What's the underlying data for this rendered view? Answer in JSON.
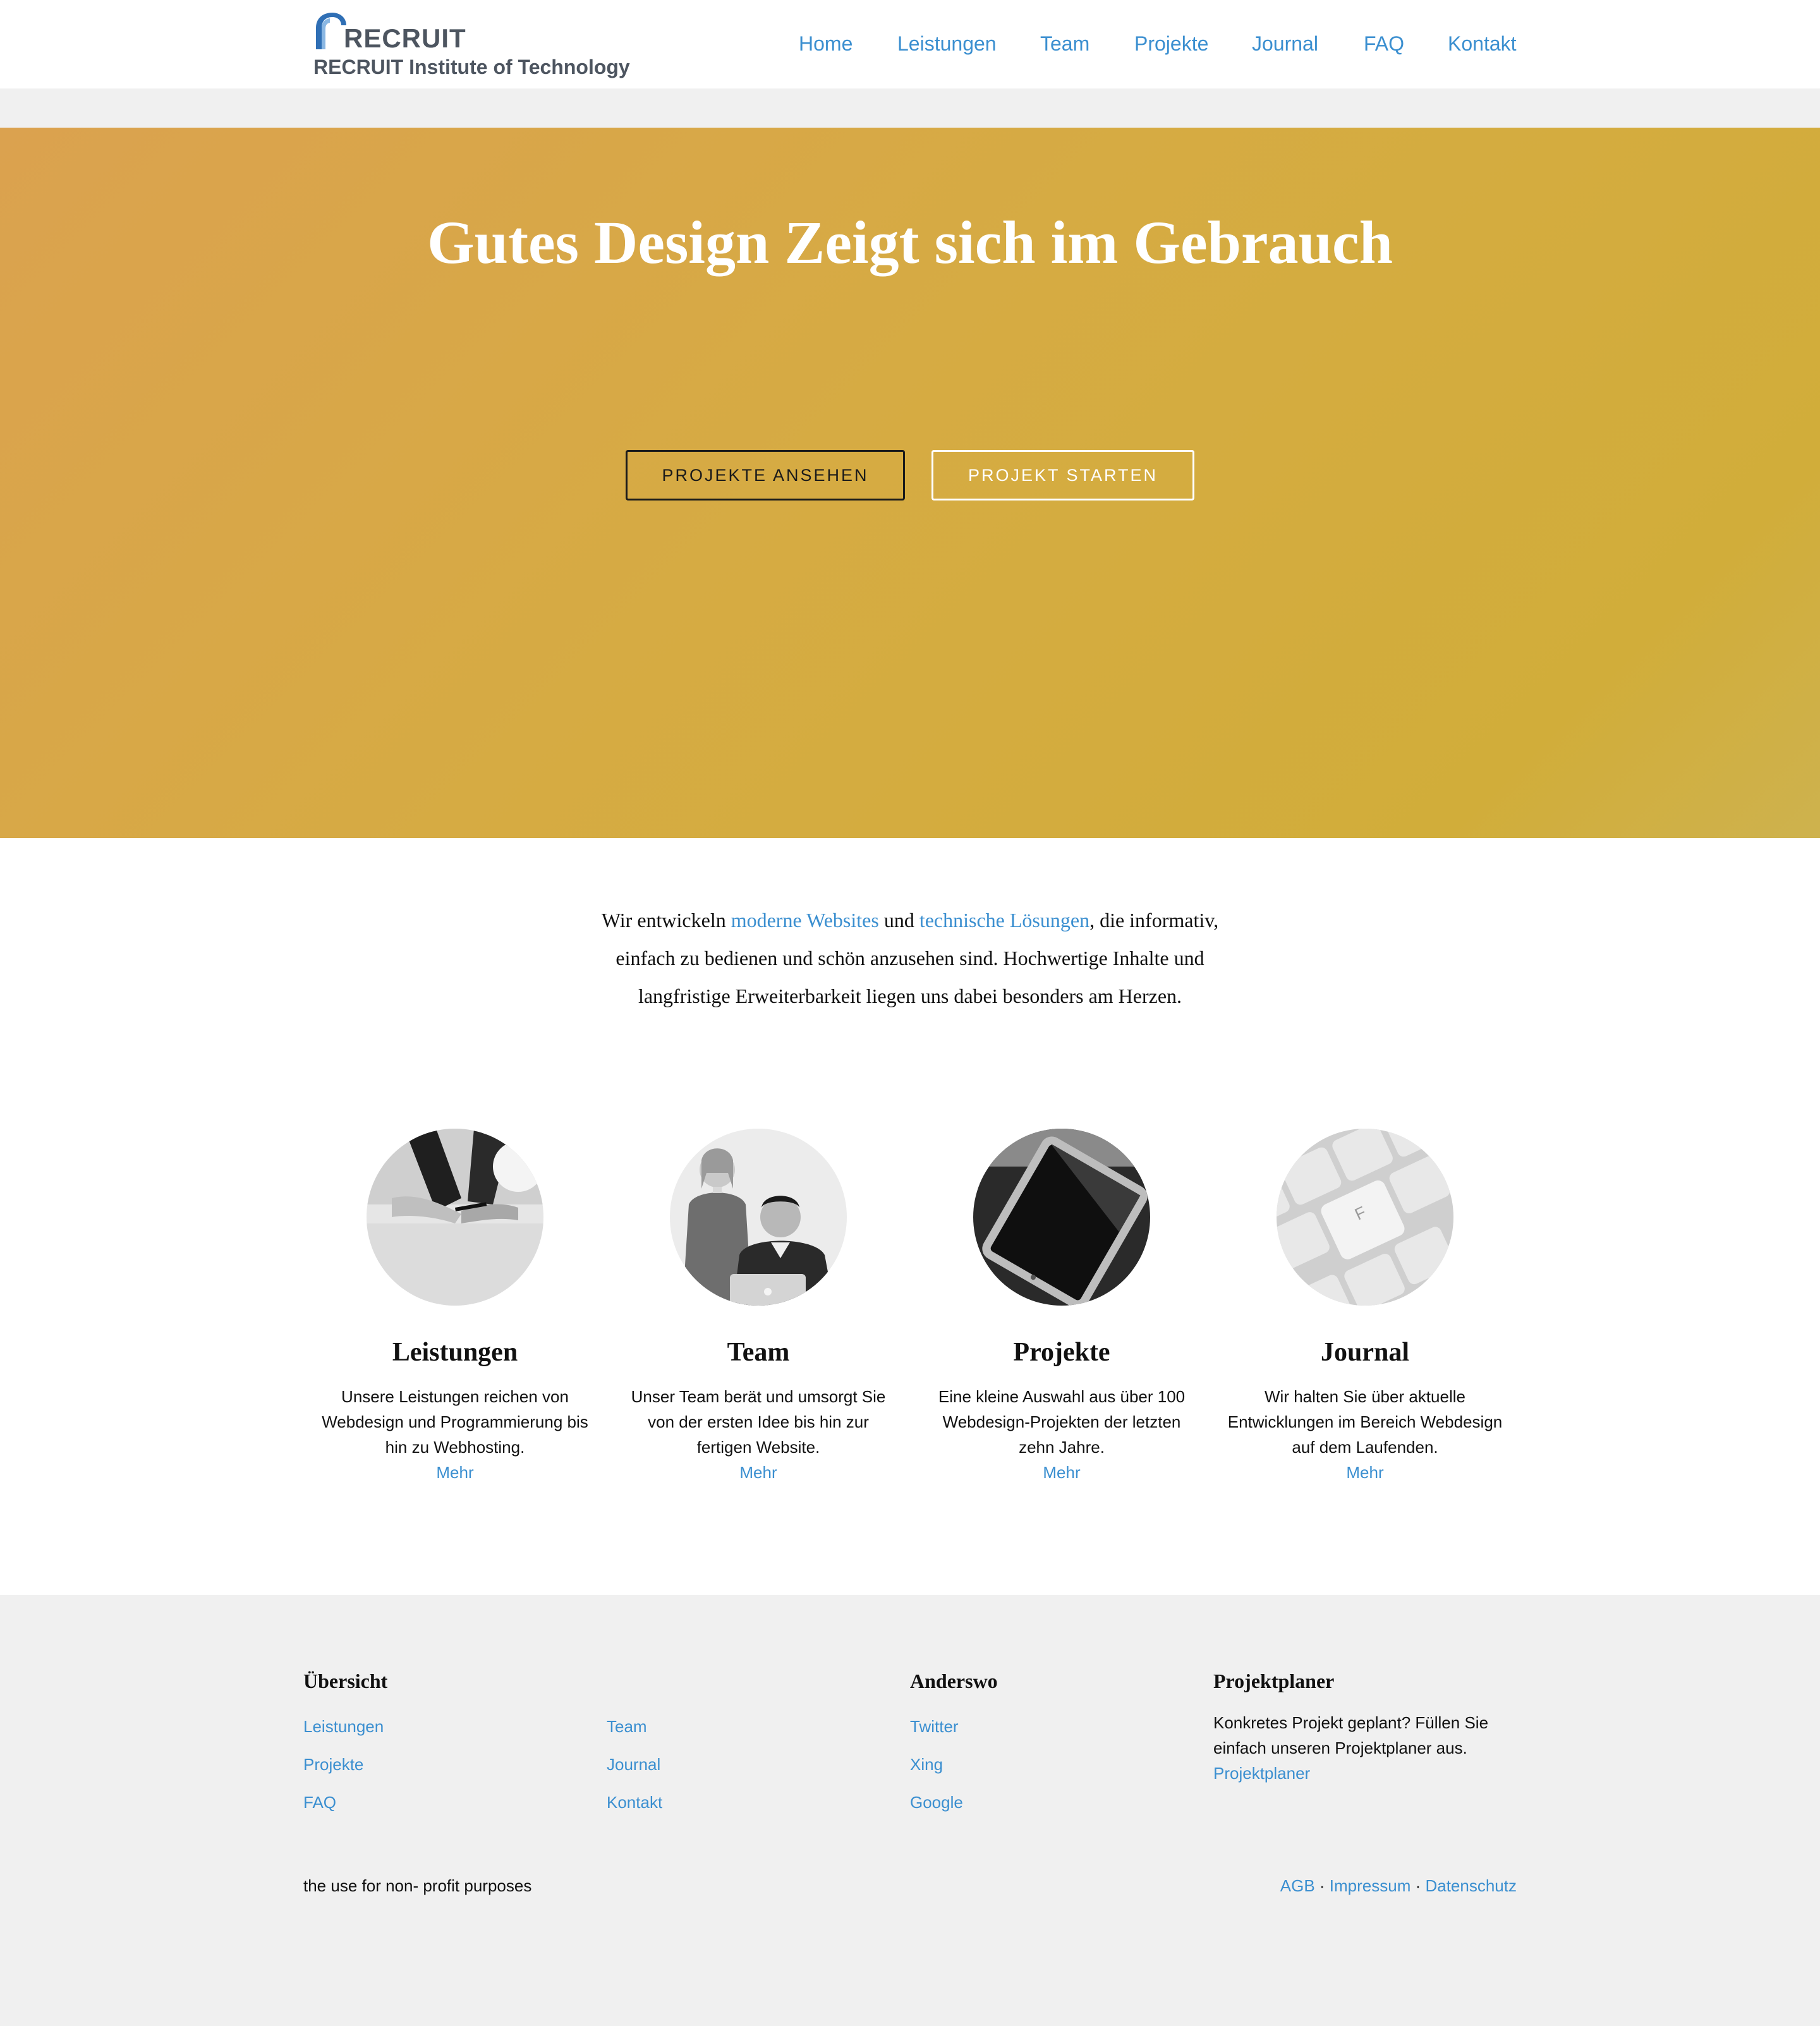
{
  "header": {
    "logo_word": "RECRUIT",
    "logo_subtitle": "RECRUIT Institute of Technology",
    "nav": [
      "Home",
      "Leistungen",
      "Team",
      "Projekte",
      "Journal",
      "FAQ",
      "Kontakt"
    ]
  },
  "hero": {
    "title": "Gutes Design Zeigt sich im Gebrauch",
    "primary_button": "PROJEKTE ANSEHEN",
    "secondary_button": "PROJEKT STARTEN"
  },
  "intro": {
    "part1": "Wir entwickeln ",
    "link1": "moderne Websites",
    "part2": " und ",
    "link2": "technische Lösungen",
    "part3": ", die informativ, einfach zu bedienen und schön anzusehen sind. Hochwertige Inhalte und langfristige Erweiterbarkeit liegen uns dabei besonders am Herzen."
  },
  "features": [
    {
      "title": "Leistungen",
      "text": "Unsere Leistungen reichen von Webdesign und Programmierung bis hin zu Webhosting.",
      "more": "Mehr",
      "image_icon": "meeting-hands-photo"
    },
    {
      "title": "Team",
      "text": "Unser Team berät und umsorgt Sie von der ersten Idee bis hin zur fertigen Website.",
      "more": "Mehr",
      "image_icon": "team-people-photo"
    },
    {
      "title": "Projekte",
      "text": "Eine kleine Auswahl aus über 100 Webdesign-Projekten der letzten zehn Jahre.",
      "more": "Mehr",
      "image_icon": "tablet-photo"
    },
    {
      "title": "Journal",
      "text": "Wir halten Sie über aktuelle Entwicklungen im Bereich Webdesign auf dem Laufenden.",
      "more": "Mehr",
      "image_icon": "keyboard-photo"
    }
  ],
  "footer": {
    "overview_heading": "Übersicht",
    "overview_links_col1": [
      "Leistungen",
      "Projekte",
      "FAQ"
    ],
    "overview_links_col2": [
      "Team",
      "Journal",
      "Kontakt"
    ],
    "elsewhere_heading": "Anderswo",
    "elsewhere_links": [
      "Twitter",
      "Xing",
      "Google"
    ],
    "planner_heading": "Projektplaner",
    "planner_text": "Konkretes Projekt geplant? Füllen Sie einfach unseren Projektplaner aus.",
    "planner_link": "Projektplaner",
    "bottom_left": "the use for non- profit purposes",
    "legal_links": [
      "AGB",
      "Impressum",
      "Datenschutz"
    ],
    "separator": " · "
  },
  "colors": {
    "link": "#3b8fd0",
    "hero_start": "#dba24f",
    "hero_end": "#ceb24e",
    "footer_bg": "#f0f0f0",
    "logo_blue": "#2f6fb5"
  }
}
